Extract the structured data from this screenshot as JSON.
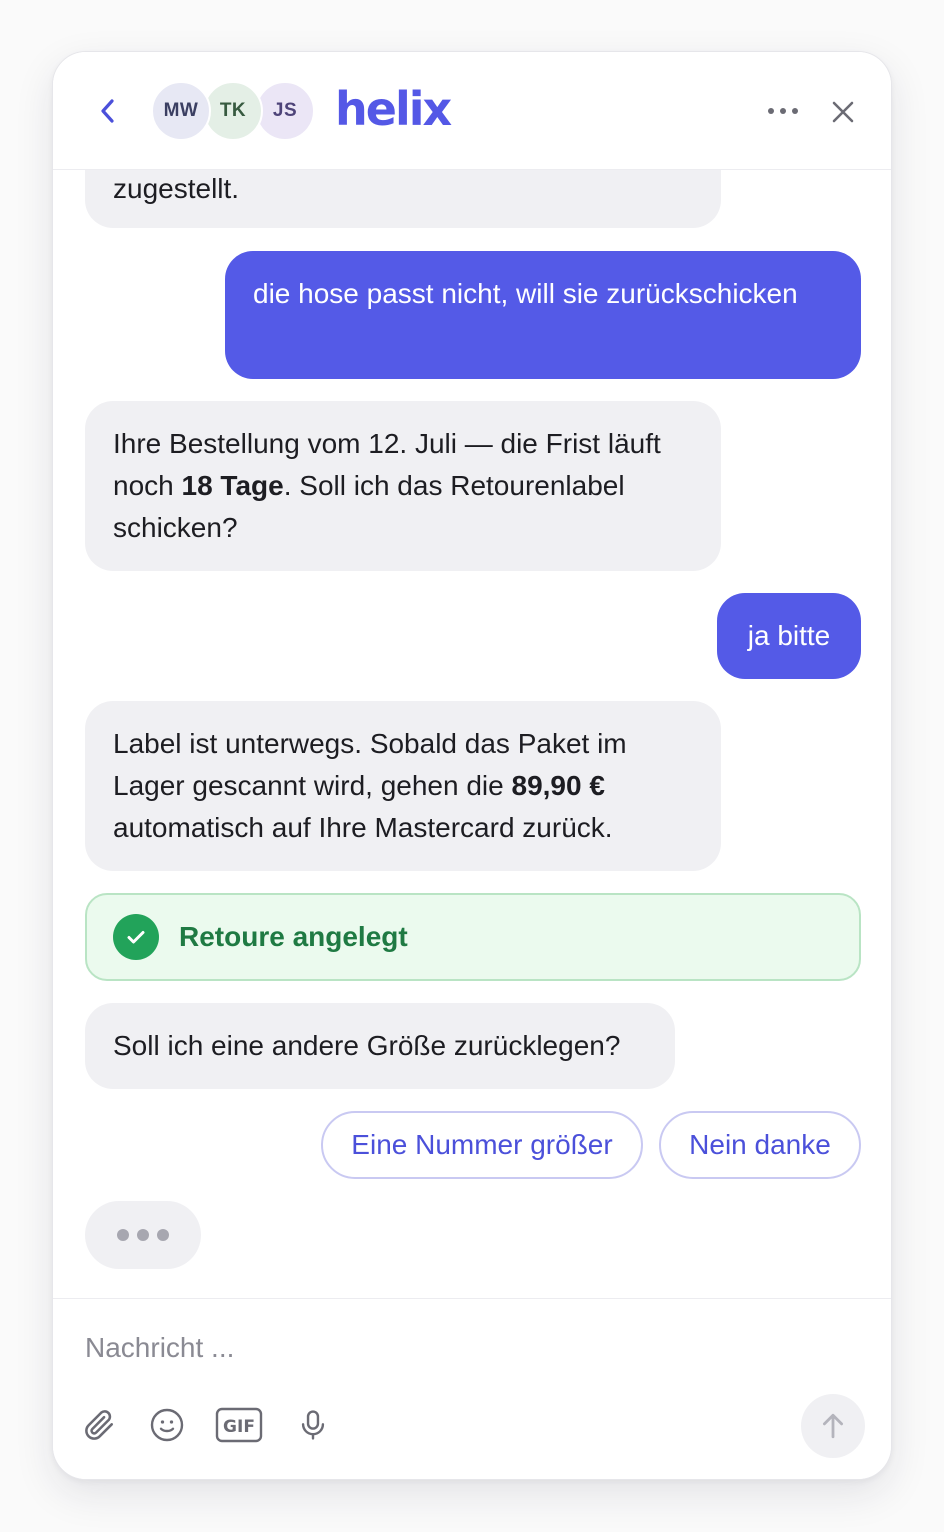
{
  "header": {
    "brand": "helix",
    "avatars": [
      "MW",
      "TK",
      "JS"
    ],
    "icons": {
      "back": "chevron-left-icon",
      "more": "more-horizontal-icon",
      "close": "close-icon"
    }
  },
  "messages": [
    {
      "role": "bot",
      "text": "zugestellt."
    },
    {
      "role": "user",
      "text": "die hose passt nicht, will sie zurückschicken"
    },
    {
      "role": "bot",
      "parts": [
        "Ihre Bestellung vom 12. Juli — die Frist läuft noch ",
        "18 Tage",
        ". Soll ich das Retourenlabel schicken?"
      ]
    },
    {
      "role": "user",
      "text": "ja bitte"
    },
    {
      "role": "bot",
      "parts": [
        "Label ist unterwegs. Sobald das Paket im Lager gescannt wird, gehen die ",
        "89,90 €",
        " automatisch auf Ihre Mastercard zurück."
      ]
    },
    {
      "role": "bot",
      "text": "Soll ich eine andere Größe zurücklegen?"
    }
  ],
  "status": {
    "text": "Retoure angelegt",
    "icon": "check-circle-icon",
    "color": "#22a35a"
  },
  "quick_replies": [
    "Eine Nummer größer",
    "Nein danke"
  ],
  "composer": {
    "placeholder": "Nachricht ...",
    "tools": [
      "paperclip-icon",
      "smiley-icon",
      "gif-icon",
      "microphone-icon"
    ],
    "gif_label": "GIF",
    "send_icon": "arrow-up-icon"
  },
  "colors": {
    "accent": "#545ae7",
    "bot_bubble": "#f0f0f3",
    "success_bg": "#ebfaee",
    "success_text": "#1f7a43"
  }
}
